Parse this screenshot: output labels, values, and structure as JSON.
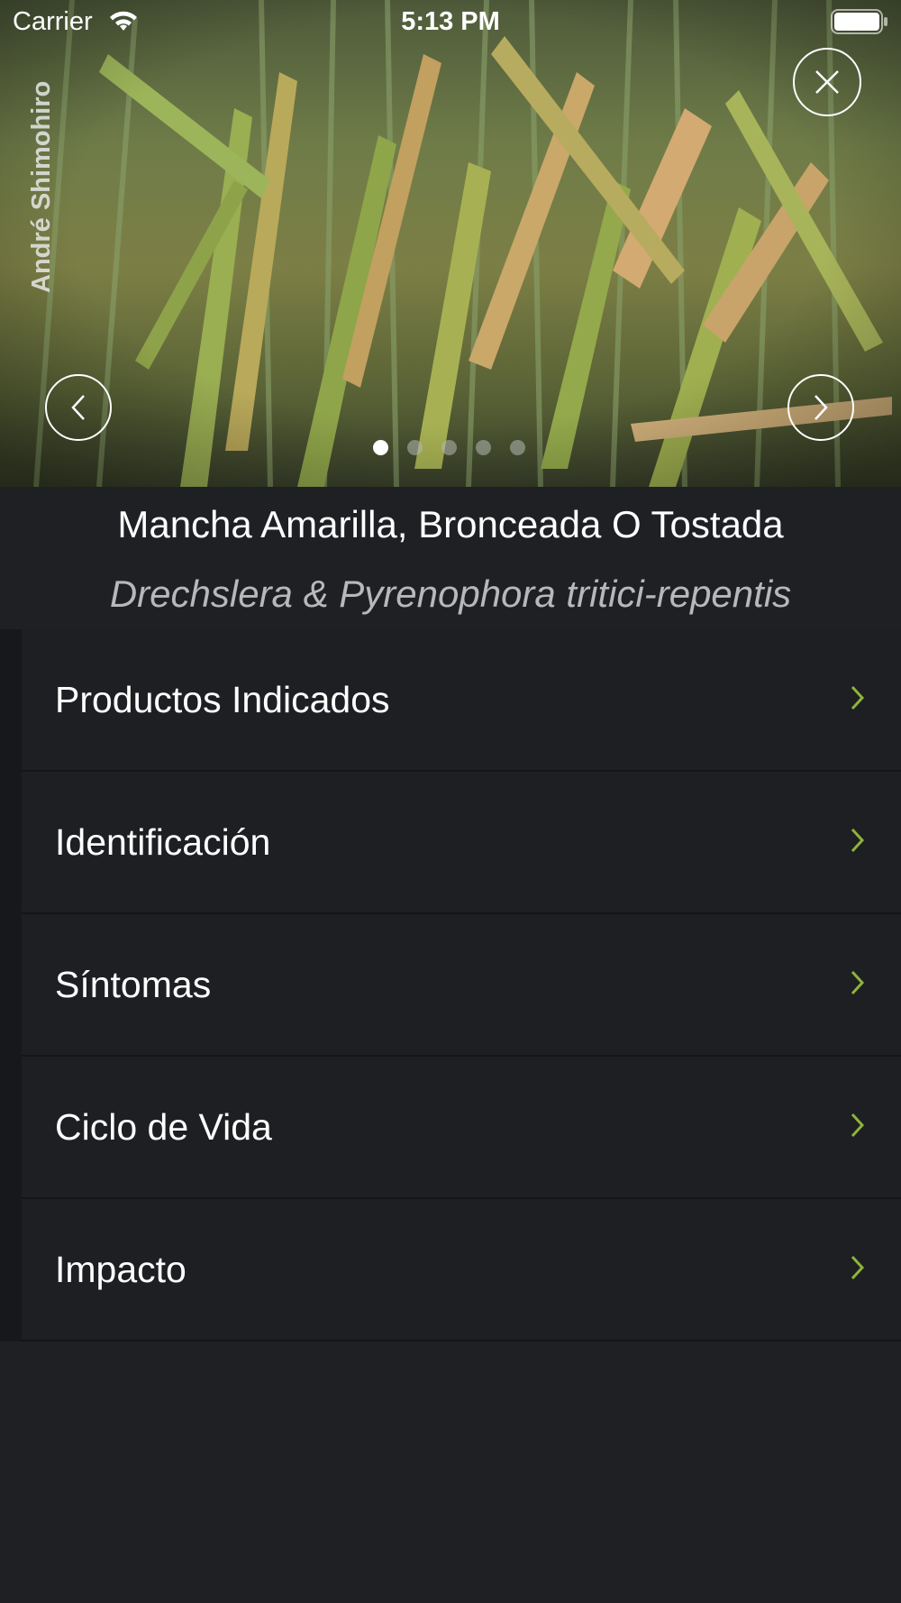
{
  "status_bar": {
    "carrier": "Carrier",
    "time": "5:13 PM"
  },
  "hero": {
    "photo_credit": "André Shimohiro",
    "slides_total": 5,
    "slide_active": 1
  },
  "title": "Mancha Amarilla, Bronceada O Tostada",
  "subtitle": "Drechslera & Pyrenophora tritici-repentis",
  "menu": {
    "items": [
      {
        "label": "Productos Indicados"
      },
      {
        "label": "Identificación"
      },
      {
        "label": "Síntomas"
      },
      {
        "label": "Ciclo de Vida"
      },
      {
        "label": "Impacto"
      }
    ]
  },
  "colors": {
    "accent_chevron": "#8db43a",
    "background": "#1f2024",
    "row": "#1e1f23"
  },
  "icons": {
    "close": "close-icon",
    "prev": "chevron-left-icon",
    "next": "chevron-right-icon",
    "row_chevron": "chevron-right-icon"
  }
}
